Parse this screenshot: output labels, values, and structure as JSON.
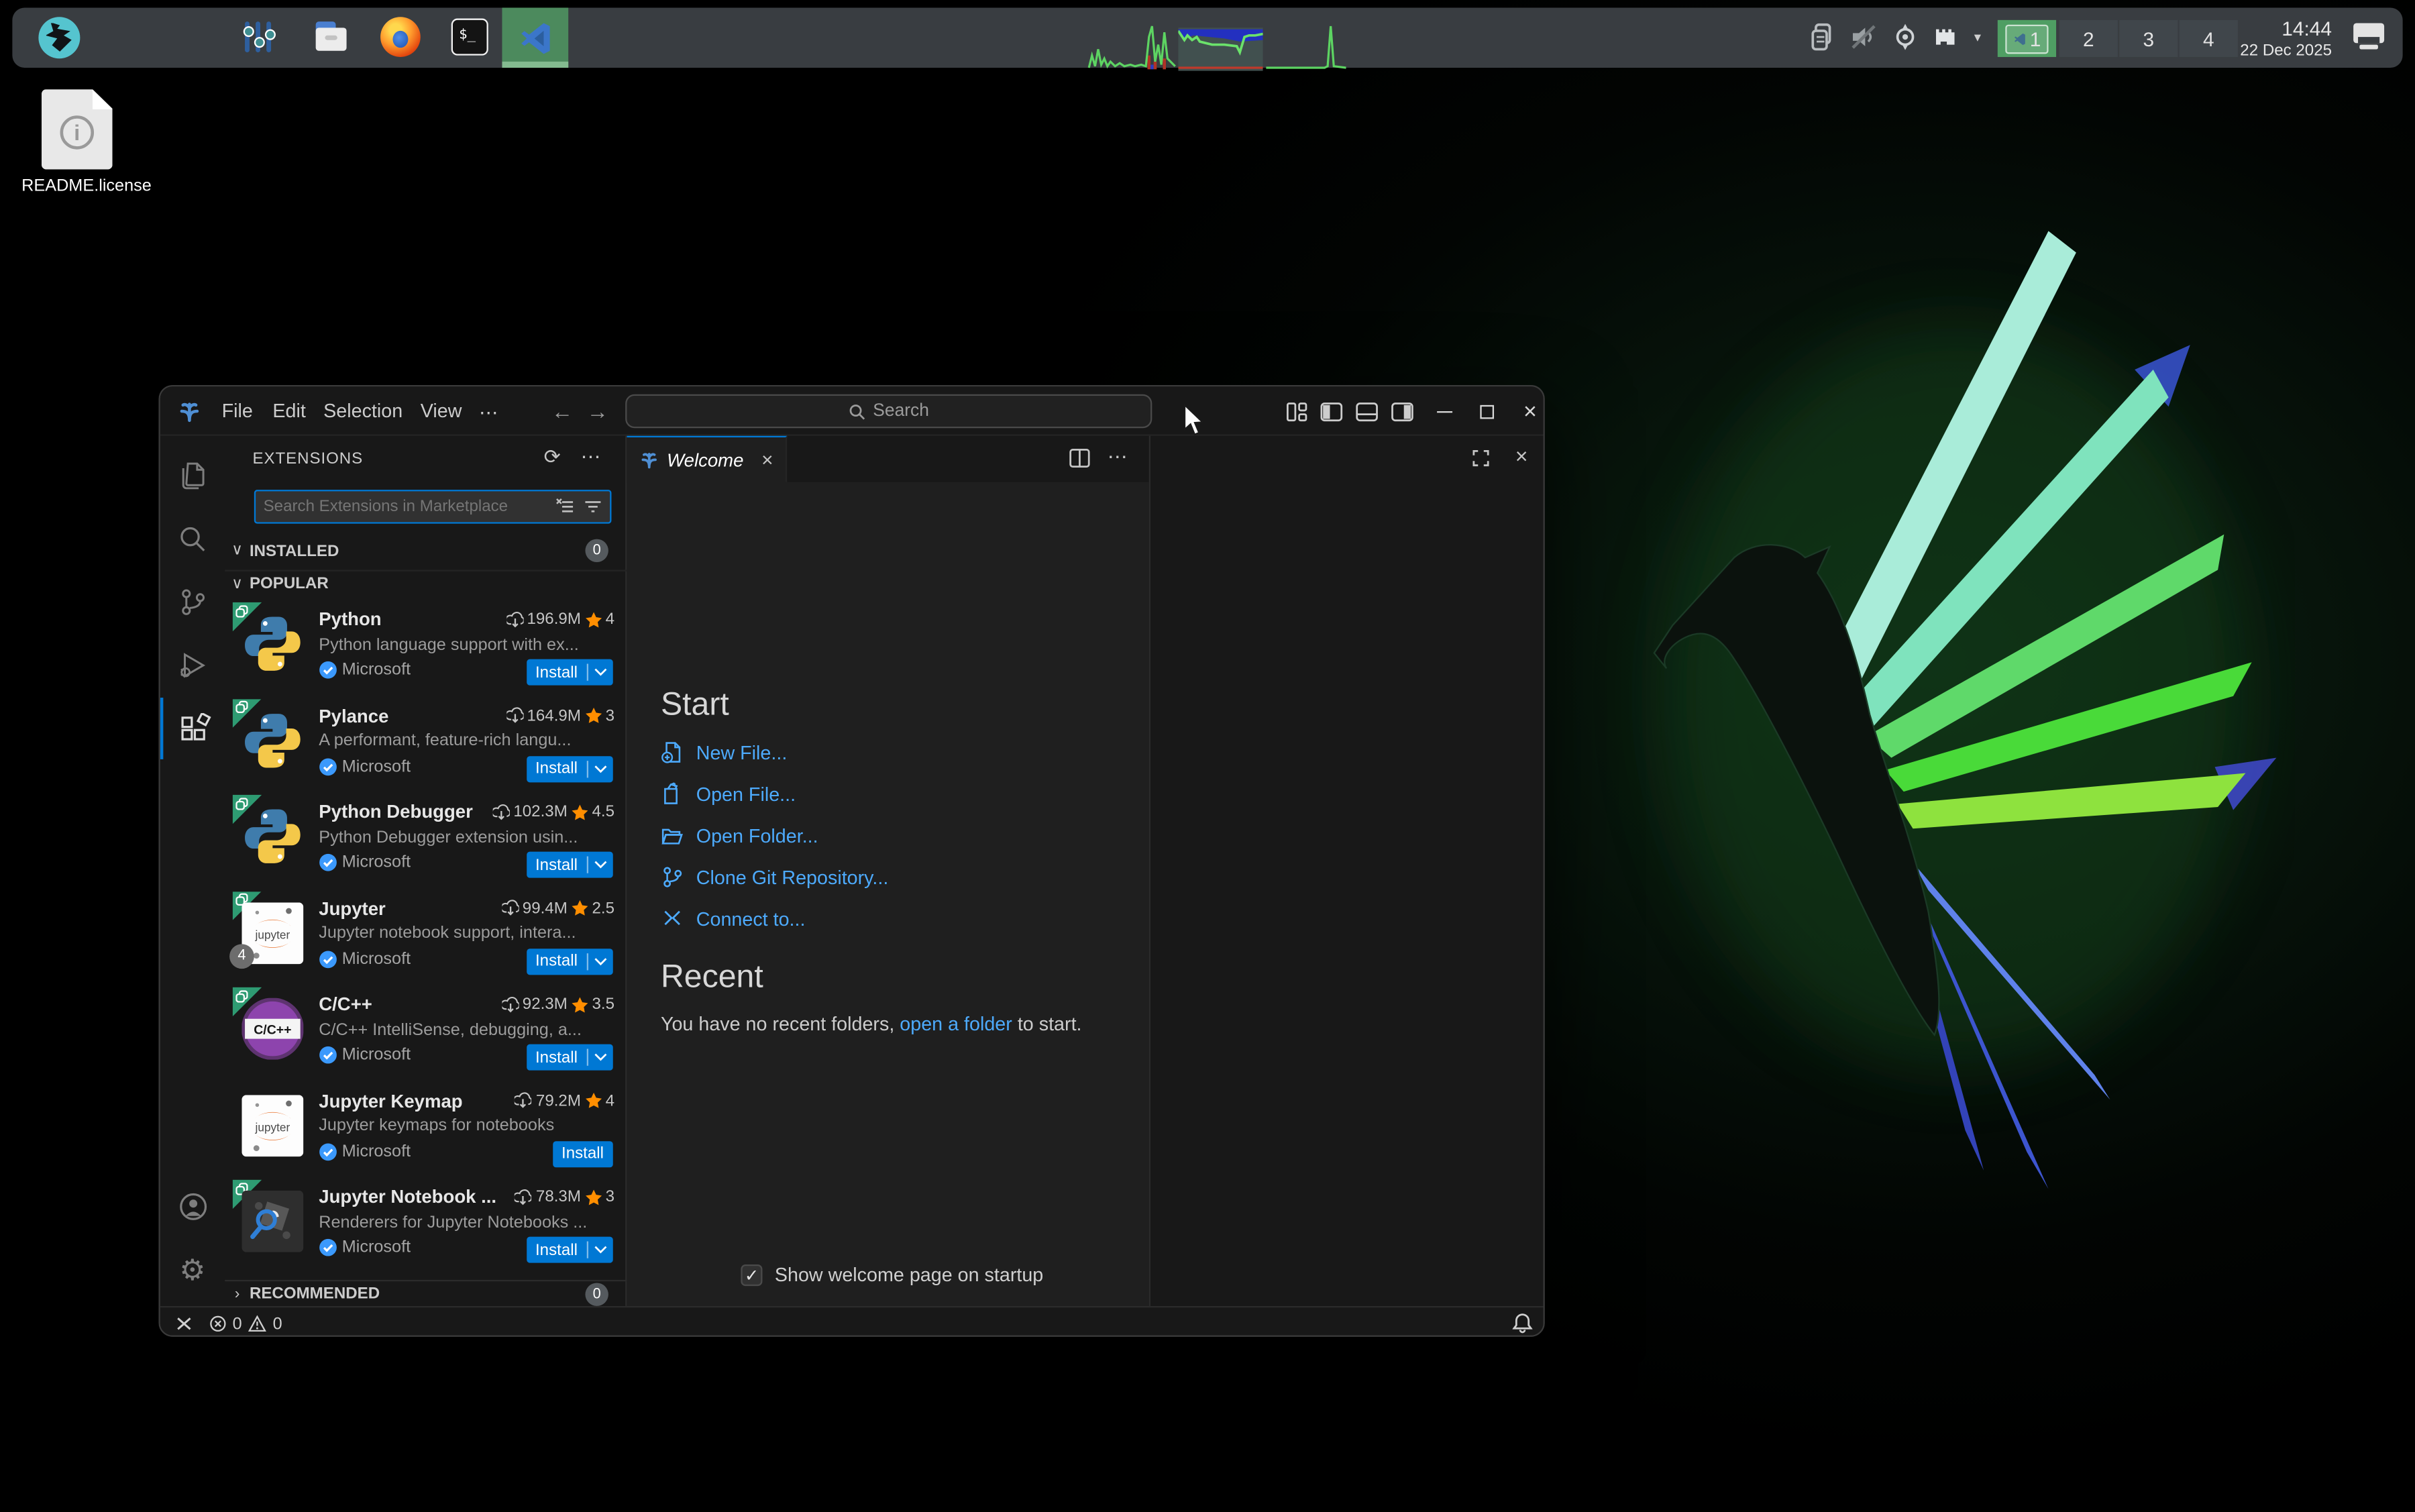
{
  "colors": {
    "accent_blue": "#0078d4",
    "link_blue": "#4daafc",
    "install_blue": "#0078d4",
    "ribbon_green": "#2e9b72",
    "workspace_green": "#4f9e63",
    "star_orange": "#ff8e00",
    "taskbar_bg": "#393d41",
    "window_bg": "#181818",
    "editor_bg": "#1f1f1f"
  },
  "icons": {
    "more": "⋯",
    "refresh": "⟳",
    "chevron_down": "∨",
    "chevron_right": "›",
    "close": "×",
    "check": "✓",
    "caret_down": "▾",
    "back": "←",
    "forward": "→",
    "gear": "⚙",
    "terminal_glyph": "$_"
  },
  "desktop": {
    "file_icon_label": "README.license"
  },
  "taskbar": {
    "workspaces": [
      {
        "label": "1",
        "active": true
      },
      {
        "label": "2",
        "active": false
      },
      {
        "label": "3",
        "active": false
      },
      {
        "label": "4",
        "active": false
      }
    ],
    "clock": {
      "time": "14:44",
      "date": "22 Dec 2025"
    }
  },
  "vscode": {
    "menu_items": [
      "File",
      "Edit",
      "Selection",
      "View"
    ],
    "command_center_placeholder": "Search",
    "tab": {
      "label": "Welcome"
    },
    "extensions": {
      "title": "EXTENSIONS",
      "search_placeholder": "Search Extensions in Marketplace",
      "installed_label": "INSTALLED",
      "installed_badge": "0",
      "popular_label": "POPULAR",
      "recommended_label": "RECOMMENDED",
      "recommended_badge": "0",
      "items": [
        {
          "name": "Python",
          "downloads": "196.9M",
          "rating": "4",
          "desc": "Python language support with ex...",
          "publisher": "Microsoft",
          "install_label": "Install",
          "dropdown": true,
          "ribbon": true,
          "icon": "python-logo"
        },
        {
          "name": "Pylance",
          "downloads": "164.9M",
          "rating": "3",
          "desc": "A performant, feature-rich langu...",
          "publisher": "Microsoft",
          "install_label": "Install",
          "dropdown": true,
          "ribbon": true,
          "icon": "python-logo"
        },
        {
          "name": "Python Debugger",
          "downloads": "102.3M",
          "rating": "4.5",
          "desc": "Python Debugger extension usin...",
          "publisher": "Microsoft",
          "install_label": "Install",
          "dropdown": true,
          "ribbon": true,
          "icon": "python-logo"
        },
        {
          "name": "Jupyter",
          "downloads": "99.4M",
          "rating": "2.5",
          "desc": "Jupyter notebook support, intera...",
          "publisher": "Microsoft",
          "install_label": "Install",
          "dropdown": true,
          "ribbon": true,
          "icon": "jupyter-logo",
          "icon_word": "jupyter",
          "count_badge": "4"
        },
        {
          "name": "C/C++",
          "downloads": "92.3M",
          "rating": "3.5",
          "desc": "C/C++ IntelliSense, debugging, a...",
          "publisher": "Microsoft",
          "install_label": "Install",
          "dropdown": true,
          "ribbon": true,
          "icon": "cpp-logo",
          "icon_text": "C/C++"
        },
        {
          "name": "Jupyter Keymap",
          "downloads": "79.2M",
          "rating": "4",
          "desc": "Jupyter keymaps for notebooks",
          "publisher": "Microsoft",
          "install_label": "Install",
          "dropdown": false,
          "ribbon": false,
          "icon": "jupyter-logo",
          "icon_word": "jupyter"
        },
        {
          "name": "Jupyter Notebook ...",
          "downloads": "78.3M",
          "rating": "3",
          "desc": "Renderers for Jupyter Notebooks ...",
          "publisher": "Microsoft",
          "install_label": "Install",
          "dropdown": true,
          "ribbon": true,
          "icon": "notebook-renderers-logo"
        }
      ]
    },
    "welcome": {
      "start_title": "Start",
      "start_items": [
        "New File...",
        "Open File...",
        "Open Folder...",
        "Clone Git Repository...",
        "Connect to..."
      ],
      "recent_title": "Recent",
      "recent_text_pre": "You have no recent folders, ",
      "recent_link": "open a folder",
      "recent_text_post": " to start.",
      "checkbox_label": "Show welcome page on startup",
      "checkbox_checked": true
    },
    "status_bar": {
      "error_count": "0",
      "warning_count": "0"
    }
  }
}
